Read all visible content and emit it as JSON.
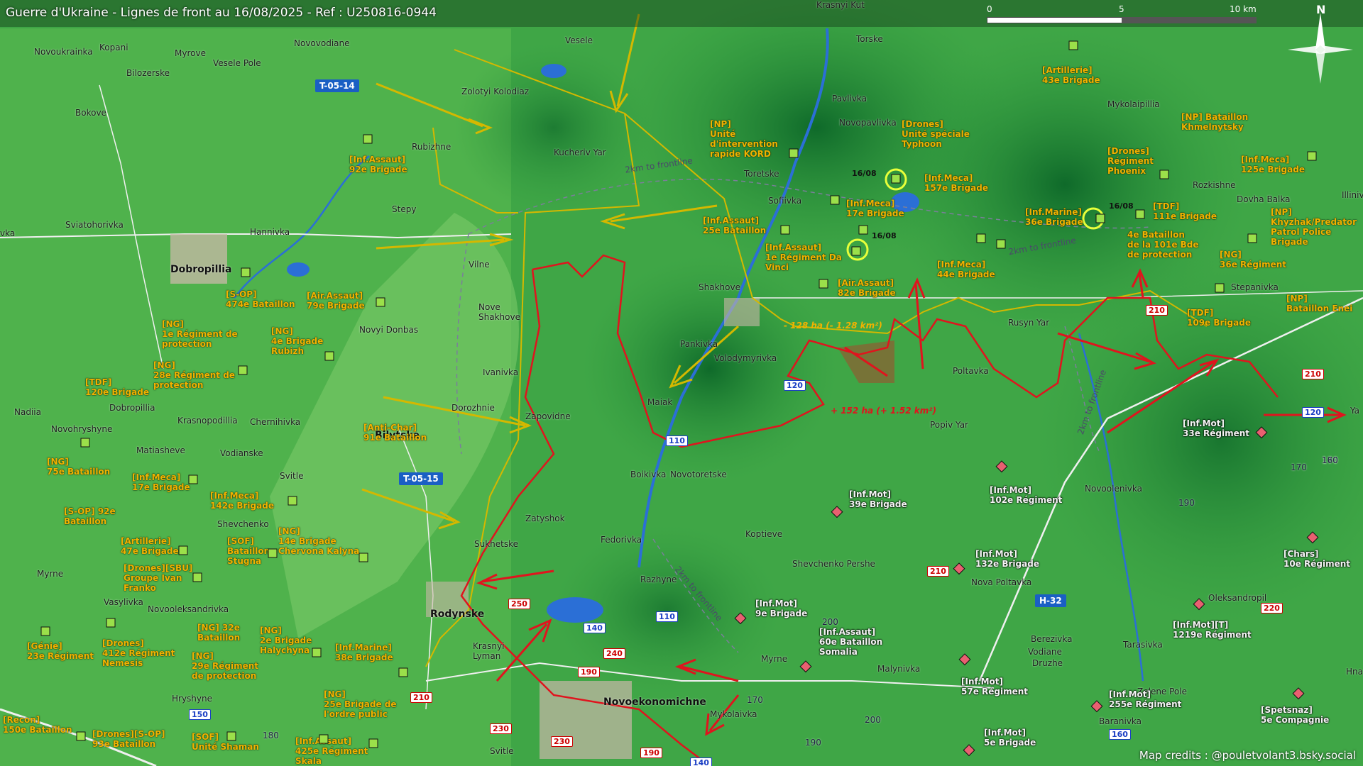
{
  "header": {
    "title": "Guerre d'Ukraine - Lignes de front au 16/08/2025 - Ref : U250816-0944",
    "scale_labels": [
      "0",
      "5",
      "10 km"
    ],
    "north_label": "N"
  },
  "colors": {
    "ukraine_units": "#f2b200",
    "russia_units": "#f5f5f5",
    "frontline_red": "#e0141e",
    "ukraine_line": "#d4b800",
    "terrain": "#3aa043"
  },
  "places": {
    "krasnyi_kut": "Krasnyi Kut",
    "torske": "Torske",
    "pavlivka": "Pavlivka",
    "novopavlivka": "Novopavlivka",
    "toretske": "Toretske",
    "sofiivka": "Sofiivka",
    "shakhove": "Shakhove",
    "pankivka": "Pankivka",
    "volodymyrivka": "Volodymyrivka",
    "maiak": "Maiak",
    "boikivka": "Boikivka",
    "novotoretske": "Novotoretske",
    "koptieve": "Koptieve",
    "shevchenko_pershe": "Shevchenko Pershe",
    "zatyshok": "Zatyshok",
    "fedorivka": "Fedorivka",
    "razhyne": "Razhyne",
    "sukhetske": "Sukhetske",
    "rodynske": "Rodynske",
    "krasnyi_lyman": "Krasnyi\nLyman",
    "novoekonomichne": "Novoekonomichne",
    "mykolaivka": "Mykolaivka",
    "myrne2": "Myrne",
    "malynivka": "Malynivka",
    "svitle": "Svitle",
    "vesele": "Vesele",
    "zolotyi_kolodiaz": "Zolotyi Kolodiaz",
    "kucheriv_yar": "Kucheriv Yar",
    "rubizhne": "Rubizhne",
    "stepy": "Stepy",
    "hannivka": "Hannivka",
    "sviatohorivka": "Sviatohorivka",
    "dobropillia": "Dobropillia",
    "vilne": "Vilne",
    "nove_shakhove": "Nove\nShakhove",
    "novyi_donbas": "Novyi Donbas",
    "ivanivka": "Ivanivka",
    "dorozhnie": "Dorozhnie",
    "zapovidne": "Zapovidne",
    "bilytske": "Bilytske",
    "svitle2": "Svitle",
    "shevchenko": "Shevchenko",
    "vodianske": "Vodianske",
    "chernihivka": "Chernihivka",
    "krasnopodillia": "Krasnopodillia",
    "dobropillia2": "Dobropillia",
    "nadiia": "Nadiia",
    "novohryshyne": "Novohryshyne",
    "matiasheve": "Matiasheve",
    "myrne": "Myrne",
    "vasylivka": "Vasylivka",
    "novooleksandrivka": "Novooleksandrivka",
    "hryshyne": "Hryshyne",
    "novoukrainka": "Novoukrainka",
    "kopani": "Kopani",
    "myrove": "Myrove",
    "vesele_pole": "Vesele Pole",
    "bilozerske": "Bilozerske",
    "novovodiane": "Novovodiane",
    "bokove": "Bokove",
    "vka": "vka",
    "mykolaipillia": "Mykolaipillia",
    "rozkishne": "Rozkishne",
    "dovha_balka": "Dovha Balka",
    "illinivka": "Illiniv",
    "stepanivka": "Stepanivka",
    "rusyn_yar": "Rusyn Yar",
    "poltavka": "Poltavka",
    "popiv_yar": "Popiv Yar",
    "novoolenivka": "Novoolenivka",
    "nova_poltavka": "Nova Poltavka",
    "oleksandropil": "Oleksandropil",
    "berezivka": "Berezivka",
    "vodiane": "Vodiane",
    "druzhe": "Druzhe",
    "tarasivka": "Tarasivka",
    "zelene_pole": "Zelene Pole",
    "baranivka": "Baranivka",
    "hna": "Hna",
    "yab": "Ya"
  },
  "ukraine_units": {
    "u1": "[Artillerie]\n43e Brigade",
    "u2": "[NP] Bataillon\nKhmelnytsky",
    "u3": "[Drones]\nRégiment\nPhoenix",
    "u4": "[Inf.Meca]\n125e Brigade",
    "u5": "[NP]\nUnité\nd'intervention\nrapide KORD",
    "u6": "[Drones]\nUnité spéciale\nTyphoon",
    "u7": "[Inf.Meca]\n157e Brigade",
    "u8": "[Inf.Meca]\n17e Brigade",
    "u9": "[Inf.Marine]\n36e Brigade",
    "u10": "[TDF]\n111e Brigade",
    "u11": "[NP]\nKhyzhak/Predator\nPatrol Police\nBrigade",
    "u12": "[Inf.Assaut]\n25e Bataillon",
    "u13": "[Inf.Assaut]\n1e Régiment Da\nVinci",
    "u14": "4e Bataillon\nde la 101e Bde\nde protection",
    "u15": "[NG]\n36e Régiment",
    "u16": "[Inf.Meca]\n44e Brigade",
    "u17": "[Air.Assaut]\n82e Brigade",
    "u18": "[NP]\nBataillon Enei",
    "u19": "[TDF]\n109e Brigade",
    "u20": "[Inf.Assaut]\n92e Brigade",
    "u21": "[S-OP]\n474e Bataillon",
    "u22": "[Air.Assaut]\n79e Brigade",
    "u23": "[NG]\n1e Régiment de\nprotection",
    "u24": "[NG]\n4e Brigade\nRubizh",
    "u25": "[NG]\n28e Régiment de\nprotection",
    "u26": "[TDF]\n120e Brigade",
    "u27": "[Anti-Char]\n91e Bataillon",
    "u28": "[NG]\n75e Bataillon",
    "u29": "[Inf.Meca]\n17e Brigade",
    "u30": "[Inf.Meca]\n142e Brigade",
    "u31": "[S-OP] 92e\nBataillon",
    "u32": "[Artillerie]\n47e Brigade",
    "u33": "[SOF]\nBataillon\nStugna",
    "u34": "[NG]\n14e Brigade\nChervona Kalyna",
    "u35": "[Drones][SBU]\nGroupe Ivan\nFranko",
    "u36": "[Génie]\n23e Régiment",
    "u37": "[Drones]\n412e Régiment\nNemesis",
    "u38": "[NG] 32e\nBataillon",
    "u39": "[NG]\n2e Brigade\nHalychyna",
    "u40": "[NG]\n29e Régiment\nde protection",
    "u41": "[Inf.Marine]\n38e Brigade",
    "u42": "[NG]\n25e Brigade de\nl'ordre public",
    "u43": "[Recon]\n150e Bataillon",
    "u44": "[Drones][S-OP]\n93e Bataillon",
    "u45": "[SOF]\nUnité Shaman",
    "u46": "[Inf.Assaut]\n425e Régiment\nSkala"
  },
  "russia_units": {
    "r1": "[Inf.Mot]\n33e Régiment",
    "r2": "[Inf.Mot]\n39e Brigade",
    "r3": "[Inf.Mot]\n102e Régiment",
    "r4": "[Inf.Mot]\n132e Brigade",
    "r5": "[Chars]\n10e Régiment",
    "r6": "[Inf.Mot]\n9e Brigade",
    "r7": "[Inf.Assaut]\n60e Bataillon\nSomalia",
    "r8": "[Inf.Mot][T]\n1219e Régiment",
    "r9": "[Inf.Mot]\n57e Régiment",
    "r10": "[Inf.Mot]\n255e Régiment",
    "r11": "[Spetsnaz]\n5e Compagnie",
    "r12": "[Inf.Mot]\n5e Brigade"
  },
  "dates": [
    "16/08",
    "16/08",
    "16/08"
  ],
  "road_signs": [
    "T-05-14",
    "T-05-15",
    "H-32"
  ],
  "road_numbers": [
    "110",
    "120",
    "120",
    "110",
    "140",
    "140",
    "150",
    "160",
    "210",
    "210",
    "210",
    "210",
    "220",
    "230",
    "230",
    "240",
    "250",
    "190",
    "190"
  ],
  "contour_numbers": [
    "170",
    "160",
    "190",
    "200",
    "200",
    "170",
    "180",
    "190"
  ],
  "annotations": {
    "loss": "- 128 ha (- 1.28 km²)",
    "gain": "+ 152 ha (+ 1.52 km²)",
    "frontline_2km": "2km to frontline"
  },
  "credits": "Map credits : @pouletvolant3.bsky.social"
}
